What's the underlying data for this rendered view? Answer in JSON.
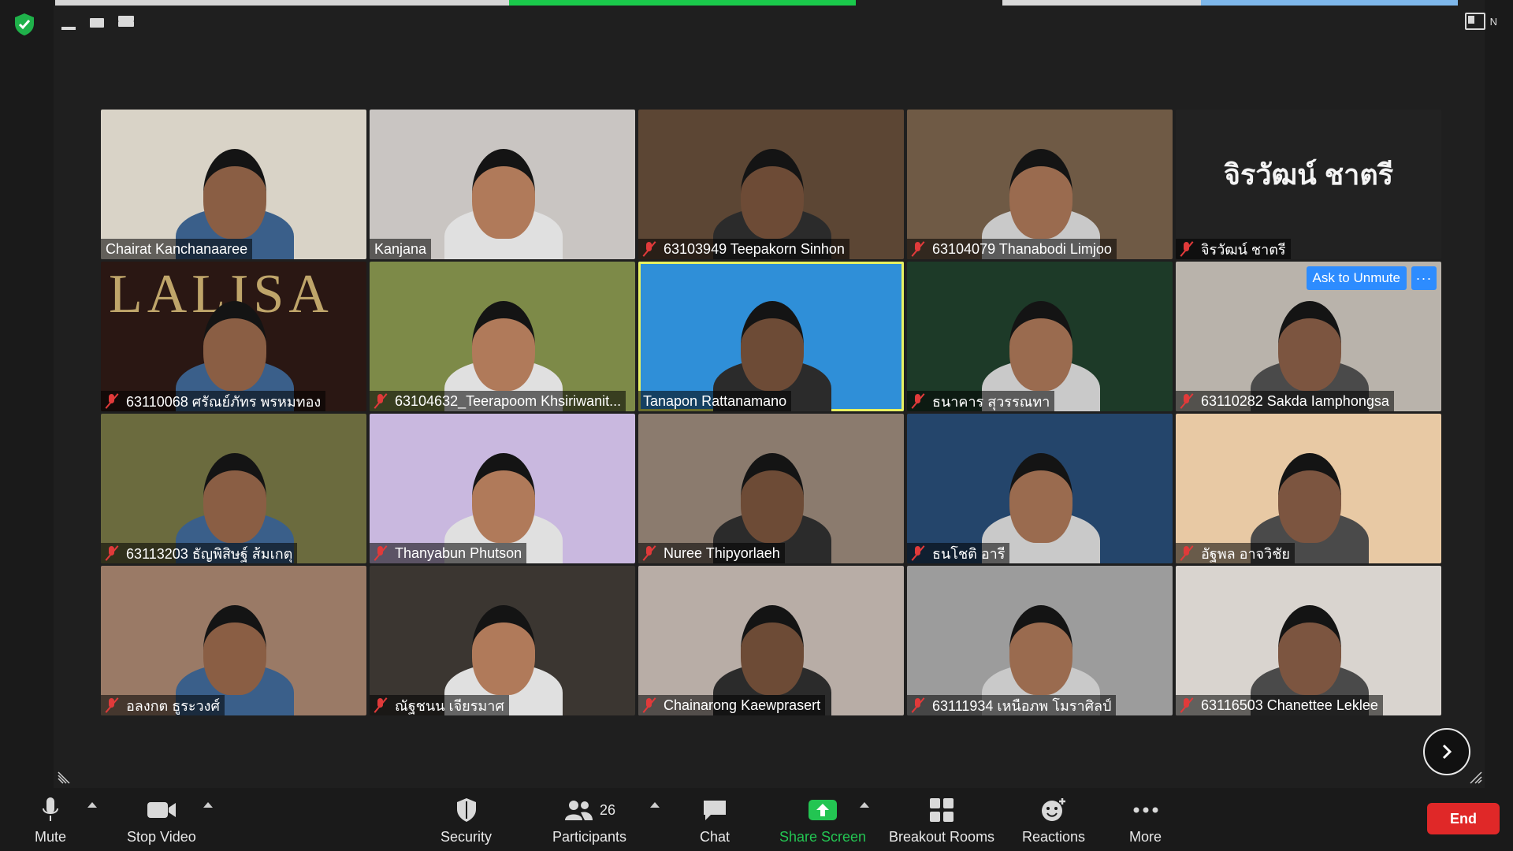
{
  "window": {
    "view_toggle_label": "N"
  },
  "tiles": [
    {
      "name": "Chairat Kanchanaaree",
      "muted": false,
      "bg": "#d9d3c7"
    },
    {
      "name": "Kanjana",
      "muted": false,
      "bg": "#c9c5c2"
    },
    {
      "name": "63103949 Teepakorn Sinhon",
      "muted": true,
      "bg": "#5c4634"
    },
    {
      "name": "63104079 Thanabodi Limjoo",
      "muted": true,
      "bg": "#6f5a45"
    },
    {
      "name": "จิรวัฒน์ ชาตรี",
      "muted": true,
      "bg": "#222222",
      "display_name": "จิรวัฒน์ ชาตรี"
    },
    {
      "name": "63110068 ศรัณย์ภัทร พรหมทอง",
      "muted": true,
      "bg": "#2a1713",
      "watermark": "LALISA"
    },
    {
      "name": "63104632_Teerapoom Khsiriwanit...",
      "muted": true,
      "bg": "#7d8a48"
    },
    {
      "name": "Tanapon Rattanamano",
      "muted": false,
      "bg": "#2f8fd8",
      "active": true
    },
    {
      "name": "ธนาคาร สุวรรณทา",
      "muted": true,
      "bg": "#1d3a28"
    },
    {
      "name": "63110282 Sakda Iamphongsa",
      "muted": true,
      "bg": "#b9b3ab",
      "ask_unmute": "Ask to Unmute"
    },
    {
      "name": "63113203 ธัญพิสิษฐ์ ส้มเกตุ",
      "muted": true,
      "bg": "#6b6b3e"
    },
    {
      "name": "Thanyabun Phutson",
      "muted": true,
      "bg": "#c9b8df"
    },
    {
      "name": "Nuree Thipyorlaeh",
      "muted": true,
      "bg": "#8b7b6e"
    },
    {
      "name": "ธนโชติ อารี",
      "muted": true,
      "bg": "#24456b"
    },
    {
      "name": "อัฐพล อาจวิชัย",
      "muted": true,
      "bg": "#e8c9a4"
    },
    {
      "name": "อลงกต ธูระวงศ์",
      "muted": true,
      "bg": "#9a7a66"
    },
    {
      "name": "ณัฐชนน เจียรมาศ",
      "muted": true,
      "bg": "#3b3631"
    },
    {
      "name": "Chainarong Kaewprasert",
      "muted": true,
      "bg": "#b8ada6"
    },
    {
      "name": "63111934 เหนือภพ โมราศิลป์",
      "muted": true,
      "bg": "#9c9c9c"
    },
    {
      "name": "63116503 Chanettee Leklee",
      "muted": true,
      "bg": "#d9d4cf"
    }
  ],
  "toolbar": {
    "mute": "Mute",
    "stop_video": "Stop Video",
    "security": "Security",
    "participants": "Participants",
    "participants_count": "26",
    "chat": "Chat",
    "share_screen": "Share Screen",
    "breakout_rooms": "Breakout Rooms",
    "reactions": "Reactions",
    "more": "More",
    "end": "End"
  },
  "colors": {
    "share_green": "#23c552",
    "end_red": "#e02828",
    "active_speaker": "#e7f061",
    "accent_blue": "#2d8cff"
  }
}
